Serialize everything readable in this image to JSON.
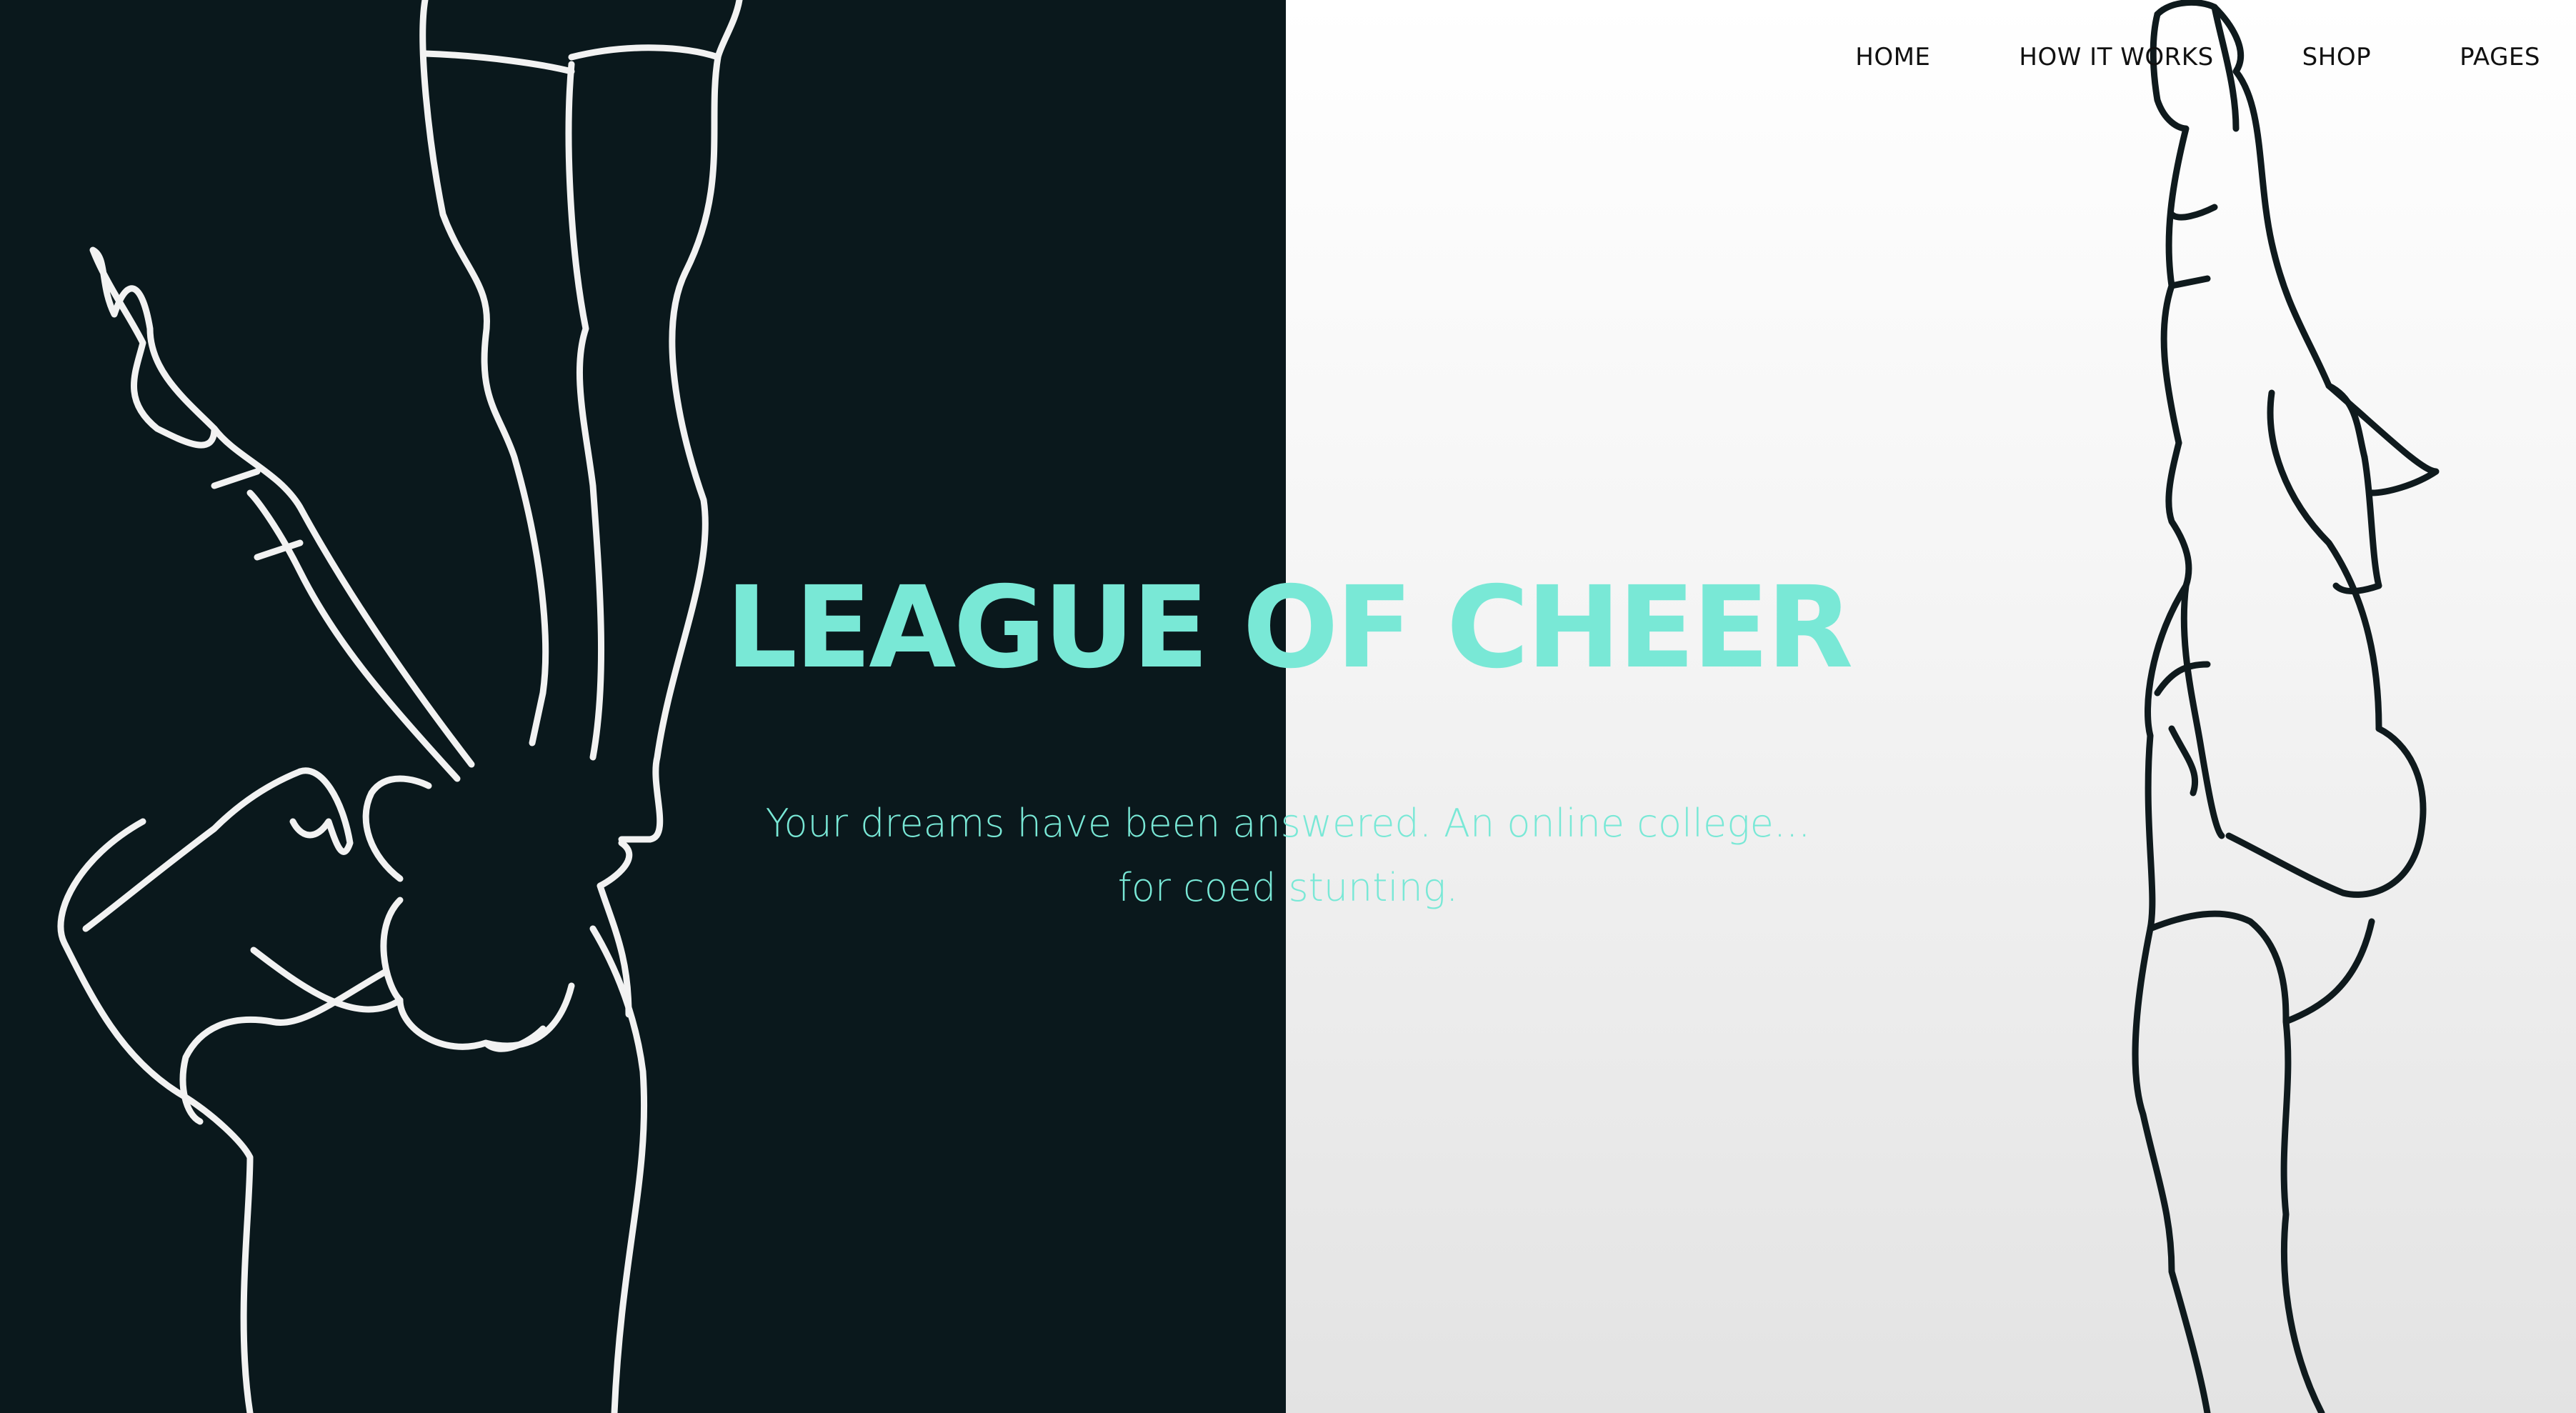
{
  "nav": {
    "items": [
      {
        "label": "HOME"
      },
      {
        "label": "HOW IT WORKS"
      },
      {
        "label": "SHOP"
      },
      {
        "label": "PAGES"
      }
    ]
  },
  "hero": {
    "title": "LEAGUE OF CHEER",
    "subtitle_line1": "Your dreams have been answered. An online college...",
    "subtitle_line2": "for coed stunting."
  },
  "colors": {
    "left_panel": "#0a181c",
    "right_panel": "#f4f4f4",
    "accent": "#79e8d6",
    "nav_text": "#111111"
  }
}
